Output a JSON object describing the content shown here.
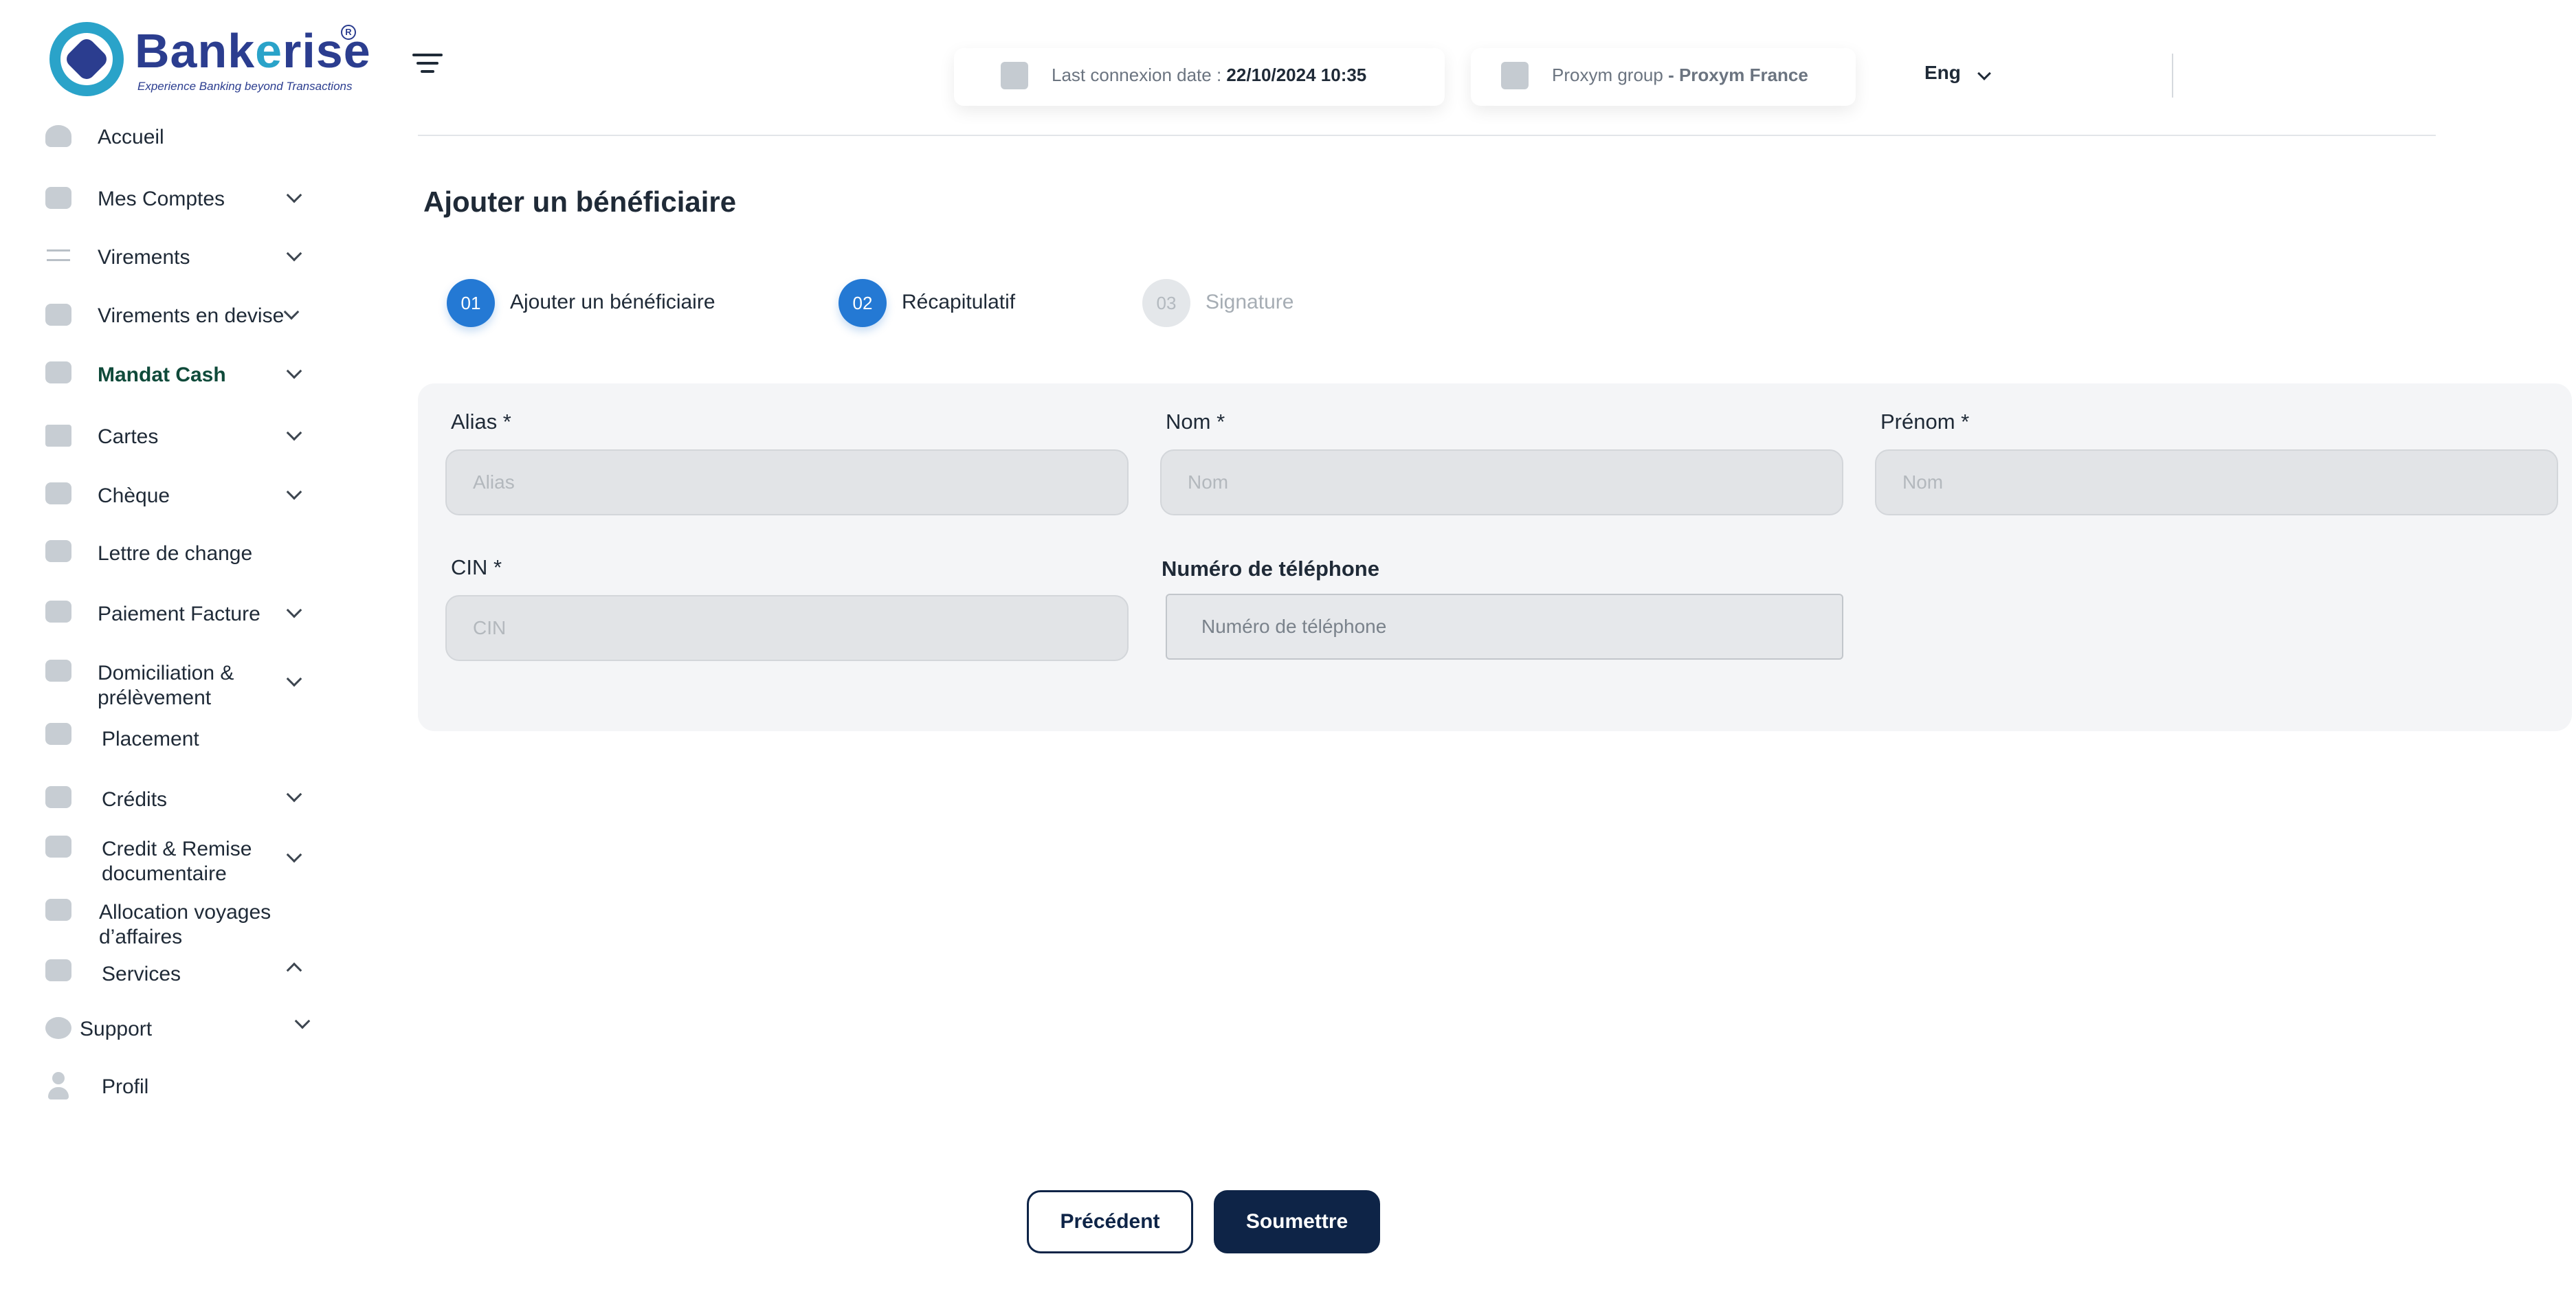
{
  "brand": {
    "name_part1": "Bank",
    "name_part2": "e",
    "name_part3": "rise",
    "registered": "R",
    "tagline": "Experience Banking beyond Transactions"
  },
  "sidebar": {
    "items": [
      {
        "label": "Accueil",
        "icon": "home-icon"
      },
      {
        "label": "Mes Comptes",
        "icon": "folder-icon"
      },
      {
        "label": "Virements",
        "icon": "transfer-icon"
      },
      {
        "label": "Virements en devise",
        "icon": "currency-icon"
      },
      {
        "label": "Mandat Cash",
        "icon": "envelope-icon"
      },
      {
        "label": "Cartes",
        "icon": "card-icon"
      },
      {
        "label": "Chèque",
        "icon": "cheque-icon"
      },
      {
        "label": "Lettre de change",
        "icon": "envelope-icon"
      },
      {
        "label": "Paiement Facture",
        "icon": "invoice-icon"
      },
      {
        "label": "Domiciliation &",
        "label2": "prélèvement",
        "icon": "envelope-icon"
      },
      {
        "label": "Placement",
        "icon": "chart-icon"
      },
      {
        "label": "Crédits",
        "icon": "envelope-icon"
      },
      {
        "label": "Credit & Remise",
        "label2": "documentaire",
        "icon": "envelope-icon"
      },
      {
        "label": "Allocation  voyages",
        "label2": "d’affaires",
        "icon": "envelope-icon"
      },
      {
        "label": "Services",
        "icon": "envelope-icon"
      },
      {
        "label": "Support",
        "icon": "support-icon"
      },
      {
        "label": "Profil",
        "icon": "user-icon"
      }
    ]
  },
  "header": {
    "last_connexion_label": "Last connexion date :",
    "last_connexion_value": "22/10/2024 10:35",
    "group_label": "Proxym group",
    "group_value": "- Proxym France",
    "language": "Eng"
  },
  "main": {
    "title": "Ajouter un bénéficiaire",
    "steps": [
      {
        "number": "01",
        "label": "Ajouter un bénéficiaire",
        "state": "active"
      },
      {
        "number": "02",
        "label": "Récapitulatif",
        "state": "active"
      },
      {
        "number": "03",
        "label": "Signature",
        "state": "inactive"
      }
    ],
    "form": {
      "alias": {
        "label": "Alias *",
        "placeholder": "Alias",
        "value": ""
      },
      "nom": {
        "label": "Nom *",
        "placeholder": "Nom",
        "value": ""
      },
      "prenom": {
        "label": "Prénom *",
        "placeholder": "Nom",
        "value": ""
      },
      "cin": {
        "label": "CIN *",
        "placeholder": "CIN",
        "value": ""
      },
      "telephone": {
        "label": "Numéro de téléphone",
        "placeholder": "Numéro de téléphone",
        "value": ""
      }
    },
    "buttons": {
      "previous": "Précédent",
      "submit": "Soumettre"
    }
  },
  "colors": {
    "brand_blue": "#2b3d8f",
    "brand_teal": "#2aa3c9",
    "step_active": "#2479d4",
    "primary_button": "#0e2447",
    "active_nav": "#0f4a3a"
  }
}
